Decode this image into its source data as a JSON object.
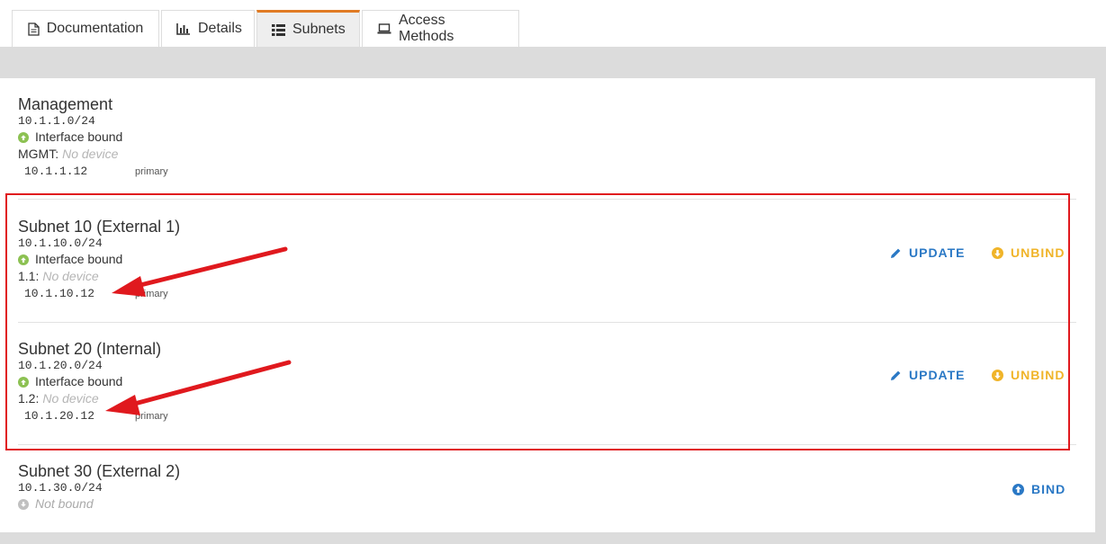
{
  "tabs": [
    {
      "label": "Documentation",
      "icon": "document-icon",
      "active": false
    },
    {
      "label": "Details",
      "icon": "bar-chart-icon",
      "active": false
    },
    {
      "label": "Subnets",
      "icon": "list-icon",
      "active": true
    },
    {
      "label": "Access Methods",
      "icon": "laptop-icon",
      "active": false
    }
  ],
  "subnets": [
    {
      "name": "Management",
      "cidr": "10.1.1.0/24",
      "status": "Interface bound",
      "iface": "MGMT:",
      "device": "No device",
      "ip": "10.1.1.12",
      "role": "primary"
    },
    {
      "name": "Subnet 10 (External 1)",
      "cidr": "10.1.10.0/24",
      "status": "Interface bound",
      "iface": "1.1:",
      "device": "No device",
      "ip": "10.1.10.12",
      "role": "primary"
    },
    {
      "name": "Subnet 20 (Internal)",
      "cidr": "10.1.20.0/24",
      "status": "Interface bound",
      "iface": "1.2:",
      "device": "No device",
      "ip": "10.1.20.12",
      "role": "primary"
    },
    {
      "name": "Subnet 30 (External 2)",
      "cidr": "10.1.30.0/24",
      "status": "Not bound"
    }
  ],
  "actions": {
    "update": "UPDATE",
    "unbind": "UNBIND",
    "bind": "BIND"
  },
  "colors": {
    "accent_tab": "#e07b24",
    "update": "#2a78c5",
    "unbind": "#f0b429",
    "bound": "#8cc152",
    "annotation": "#e0191e"
  }
}
